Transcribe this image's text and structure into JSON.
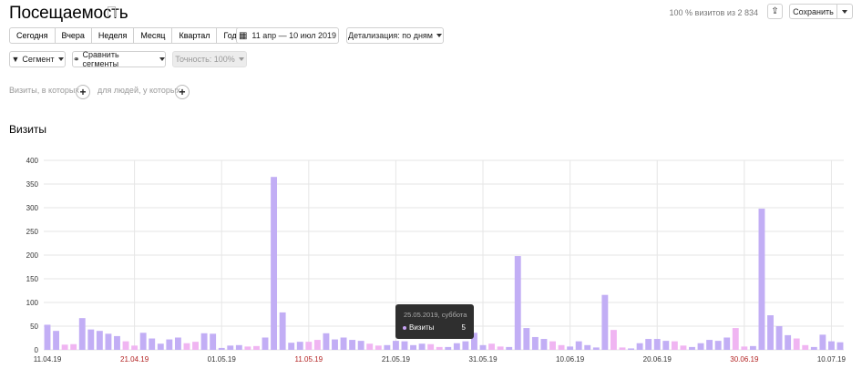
{
  "header": {
    "title": "Посещаемость",
    "visits_share": "100 % визитов из 2 834",
    "save_label": "Сохранить"
  },
  "period_tabs": [
    "Сегодня",
    "Вчера",
    "Неделя",
    "Месяц",
    "Квартал",
    "Год"
  ],
  "date_range": "11 апр — 10 июл 2019",
  "detail": "Детализация: по дням",
  "segment_btn": "Сегмент",
  "compare_btn": "Сравнить сегменты",
  "accuracy": "Точность:  100%",
  "filters": {
    "visits_label": "Визиты, в которых",
    "people_label": "для людей, у которых"
  },
  "section_title": "Визиты",
  "tooltip": {
    "date": "25.05.2019, суббота",
    "label": "Визиты",
    "value": "5"
  },
  "colors": {
    "bar": "#c2aef5",
    "weekend_bar": "#f0b5f2",
    "weekend_tick": "#b22222",
    "grid": "#e6e6e6"
  },
  "chart_data": {
    "type": "bar",
    "x_start": "11.04.19",
    "ylim": [
      0,
      400
    ],
    "yticks": [
      0,
      50,
      100,
      150,
      200,
      250,
      300,
      350,
      400
    ],
    "xticks": [
      "11.04.19",
      "21.04.19",
      "01.05.19",
      "11.05.19",
      "21.05.19",
      "31.05.19",
      "10.06.19",
      "20.06.19",
      "30.06.19",
      "10.07.19"
    ],
    "weekend_xticks": [
      "21.04.19",
      "11.05.19",
      "30.06.19"
    ],
    "values": [
      53,
      40,
      11,
      12,
      67,
      43,
      40,
      34,
      29,
      18,
      9,
      36,
      24,
      13,
      22,
      26,
      14,
      17,
      35,
      34,
      4,
      9,
      10,
      7,
      8,
      26,
      365,
      79,
      15,
      17,
      17,
      21,
      35,
      22,
      26,
      21,
      19,
      13,
      9,
      10,
      19,
      18,
      10,
      13,
      12,
      6,
      6,
      14,
      18,
      36,
      10,
      13,
      7,
      6,
      198,
      46,
      27,
      23,
      18,
      10,
      7,
      18,
      10,
      5,
      116,
      42,
      5,
      3,
      14,
      23,
      23,
      19,
      18,
      9,
      6,
      14,
      21,
      19,
      26,
      46,
      7,
      8,
      298,
      73,
      50,
      31,
      24,
      10,
      6,
      32,
      18,
      16
    ],
    "weekend_values": [
      0,
      0,
      1,
      1,
      0,
      0,
      0,
      0,
      0,
      1,
      1,
      0,
      0,
      0,
      0,
      0,
      1,
      1,
      0,
      0,
      0,
      0,
      0,
      1,
      1,
      0,
      0,
      0,
      0,
      0,
      1,
      1,
      0,
      0,
      0,
      0,
      0,
      1,
      1,
      0,
      0,
      0,
      0,
      0,
      1,
      1,
      0,
      0,
      0,
      0,
      0,
      1,
      1,
      0,
      0,
      0,
      0,
      0,
      1,
      1,
      0,
      0,
      0,
      0,
      0,
      1,
      1,
      0,
      0,
      0,
      0,
      0,
      1,
      1,
      0,
      0,
      0,
      0,
      0,
      1,
      1,
      0,
      0,
      0,
      0,
      0,
      1,
      1,
      0,
      0,
      0
    ]
  }
}
